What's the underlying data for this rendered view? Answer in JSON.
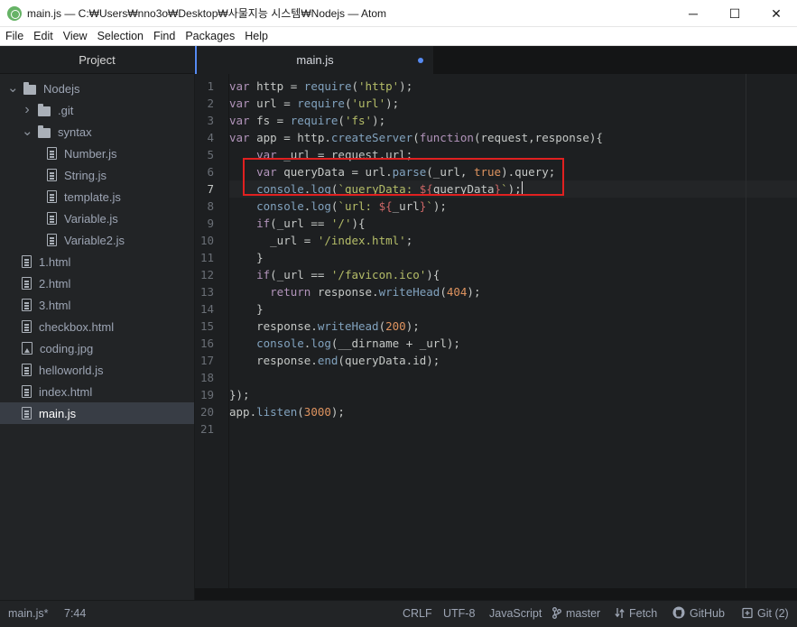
{
  "window": {
    "title": "main.js — C:₩Users₩nno3o₩Desktop₩사물지능 시스템₩Nodejs — Atom",
    "controls": [
      "─",
      "☐",
      "✕"
    ]
  },
  "menu": [
    "File",
    "Edit",
    "View",
    "Selection",
    "Find",
    "Packages",
    "Help"
  ],
  "sidebar": {
    "title": "Project",
    "tree": [
      {
        "label": "Nodejs",
        "kind": "folder",
        "depth": 0,
        "chevron": "down"
      },
      {
        "label": ".git",
        "kind": "folder",
        "depth": 1,
        "chevron": "right"
      },
      {
        "label": "syntax",
        "kind": "folder",
        "depth": 1,
        "chevron": "down"
      },
      {
        "label": "Number.js",
        "kind": "file",
        "depth": 2
      },
      {
        "label": "String.js",
        "kind": "file",
        "depth": 2
      },
      {
        "label": "template.js",
        "kind": "file",
        "depth": 2
      },
      {
        "label": "Variable.js",
        "kind": "file",
        "depth": 2
      },
      {
        "label": "Variable2.js",
        "kind": "file",
        "depth": 2
      },
      {
        "label": "1.html",
        "kind": "file",
        "depth": 1
      },
      {
        "label": "2.html",
        "kind": "file",
        "depth": 1
      },
      {
        "label": "3.html",
        "kind": "file",
        "depth": 1
      },
      {
        "label": "checkbox.html",
        "kind": "file",
        "depth": 1
      },
      {
        "label": "coding.jpg",
        "kind": "image",
        "depth": 1
      },
      {
        "label": "helloworld.js",
        "kind": "file",
        "depth": 1
      },
      {
        "label": "index.html",
        "kind": "file",
        "depth": 1
      },
      {
        "label": "main.js",
        "kind": "file",
        "depth": 1,
        "selected": true
      }
    ]
  },
  "editor": {
    "tab_label": "main.js",
    "cursor_line": 7,
    "lines": [
      [
        [
          "var",
          "kw"
        ],
        [
          " http = ",
          "pl"
        ],
        [
          "require",
          "fn"
        ],
        [
          "(",
          "pl"
        ],
        [
          "'http'",
          "st"
        ],
        [
          ");",
          "pl"
        ]
      ],
      [
        [
          "var",
          "kw"
        ],
        [
          " url = ",
          "pl"
        ],
        [
          "require",
          "fn"
        ],
        [
          "(",
          "pl"
        ],
        [
          "'url'",
          "st"
        ],
        [
          ");",
          "pl"
        ]
      ],
      [
        [
          "var",
          "kw"
        ],
        [
          " fs = ",
          "pl"
        ],
        [
          "require",
          "fn"
        ],
        [
          "(",
          "pl"
        ],
        [
          "'fs'",
          "st"
        ],
        [
          ");",
          "pl"
        ]
      ],
      [
        [
          "var",
          "kw"
        ],
        [
          " app = http.",
          "pl"
        ],
        [
          "createServer",
          "fn"
        ],
        [
          "(",
          "pl"
        ],
        [
          "function",
          "kw"
        ],
        [
          "(request,response){",
          "pl"
        ]
      ],
      [
        [
          "    ",
          "pl"
        ],
        [
          "var",
          "kw"
        ],
        [
          " _url = request.url;",
          "pl"
        ]
      ],
      [
        [
          "    ",
          "pl"
        ],
        [
          "var",
          "kw"
        ],
        [
          " queryData = url.",
          "pl"
        ],
        [
          "parse",
          "fn"
        ],
        [
          "(_url, ",
          "pl"
        ],
        [
          "true",
          "nu"
        ],
        [
          ").query;",
          "pl"
        ]
      ],
      [
        [
          "    ",
          "pl"
        ],
        [
          "console",
          "fn"
        ],
        [
          ".",
          "pl"
        ],
        [
          "log",
          "fn"
        ],
        [
          "(",
          "pl"
        ],
        [
          "`queryData: ",
          "st"
        ],
        [
          "${",
          "in"
        ],
        [
          "queryData",
          "pl"
        ],
        [
          "}",
          "in"
        ],
        [
          "`",
          "st"
        ],
        [
          ");",
          "pl"
        ]
      ],
      [
        [
          "    ",
          "pl"
        ],
        [
          "console",
          "fn"
        ],
        [
          ".",
          "pl"
        ],
        [
          "log",
          "fn"
        ],
        [
          "(",
          "pl"
        ],
        [
          "`url: ",
          "st"
        ],
        [
          "${",
          "in"
        ],
        [
          "_url",
          "pl"
        ],
        [
          "}",
          "in"
        ],
        [
          "`",
          "st"
        ],
        [
          ");",
          "pl"
        ]
      ],
      [
        [
          "    ",
          "pl"
        ],
        [
          "if",
          "kw"
        ],
        [
          "(_url == ",
          "pl"
        ],
        [
          "'/'",
          "st"
        ],
        [
          "){",
          "pl"
        ]
      ],
      [
        [
          "      _url = ",
          "pl"
        ],
        [
          "'/index.html'",
          "st"
        ],
        [
          ";",
          "pl"
        ]
      ],
      [
        [
          "    }",
          "pl"
        ]
      ],
      [
        [
          "    ",
          "pl"
        ],
        [
          "if",
          "kw"
        ],
        [
          "(_url == ",
          "pl"
        ],
        [
          "'/favicon.ico'",
          "st"
        ],
        [
          "){",
          "pl"
        ]
      ],
      [
        [
          "      ",
          "pl"
        ],
        [
          "return",
          "kw"
        ],
        [
          " response.",
          "pl"
        ],
        [
          "writeHead",
          "fn"
        ],
        [
          "(",
          "pl"
        ],
        [
          "404",
          "nu"
        ],
        [
          ");",
          "pl"
        ]
      ],
      [
        [
          "    }",
          "pl"
        ]
      ],
      [
        [
          "    response.",
          "pl"
        ],
        [
          "writeHead",
          "fn"
        ],
        [
          "(",
          "pl"
        ],
        [
          "200",
          "nu"
        ],
        [
          ");",
          "pl"
        ]
      ],
      [
        [
          "    ",
          "pl"
        ],
        [
          "console",
          "fn"
        ],
        [
          ".",
          "pl"
        ],
        [
          "log",
          "fn"
        ],
        [
          "(",
          "pl"
        ],
        [
          "__dirname",
          "pl"
        ],
        [
          " + _url);",
          "pl"
        ]
      ],
      [
        [
          "    response.",
          "pl"
        ],
        [
          "end",
          "fn"
        ],
        [
          "(queryData.id);",
          "pl"
        ]
      ],
      [
        [
          "",
          "pl"
        ]
      ],
      [
        [
          "});",
          "pl"
        ]
      ],
      [
        [
          "app.",
          "pl"
        ],
        [
          "listen",
          "fn"
        ],
        [
          "(",
          "pl"
        ],
        [
          "3000",
          "nu"
        ],
        [
          ");",
          "pl"
        ]
      ],
      [
        [
          "",
          "pl"
        ]
      ]
    ]
  },
  "status": {
    "file": "main.js*",
    "position": "7:44",
    "line_ending": "CRLF",
    "encoding": "UTF-8",
    "grammar": "JavaScript",
    "branch": "master",
    "fetch": "Fetch",
    "github": "GitHub",
    "git": "Git (2)"
  },
  "colors": {
    "accent": "#568af2",
    "keyword": "#b294bb",
    "function": "#81a2be",
    "string": "#b5bd68",
    "number": "#de935f",
    "interp": "#cc6666",
    "plain": "#c5c8c6",
    "highlight_box": "#e02020"
  }
}
